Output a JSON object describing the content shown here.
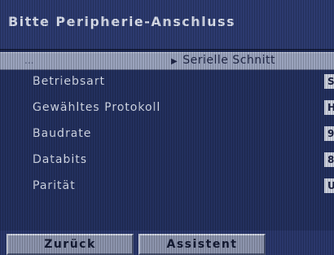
{
  "header": {
    "title": "Bitte Peripherie-Anschluss"
  },
  "path": {
    "ellipsis": "...",
    "current": "Serielle Schnitt"
  },
  "settings": [
    {
      "label": "Betriebsart",
      "value": "S"
    },
    {
      "label": "Gewähltes Protokoll",
      "value": "H"
    },
    {
      "label": "Baudrate",
      "value": "9"
    },
    {
      "label": "Databits",
      "value": "8"
    },
    {
      "label": "Parität",
      "value": "U"
    }
  ],
  "footer": {
    "back_label": "Zurück",
    "assistant_label": "Assistent"
  },
  "colors": {
    "background": "#23305e",
    "title_bar": "#2c3a6f",
    "path_bar": "#9aa3bd",
    "button": "#8c94ad"
  }
}
